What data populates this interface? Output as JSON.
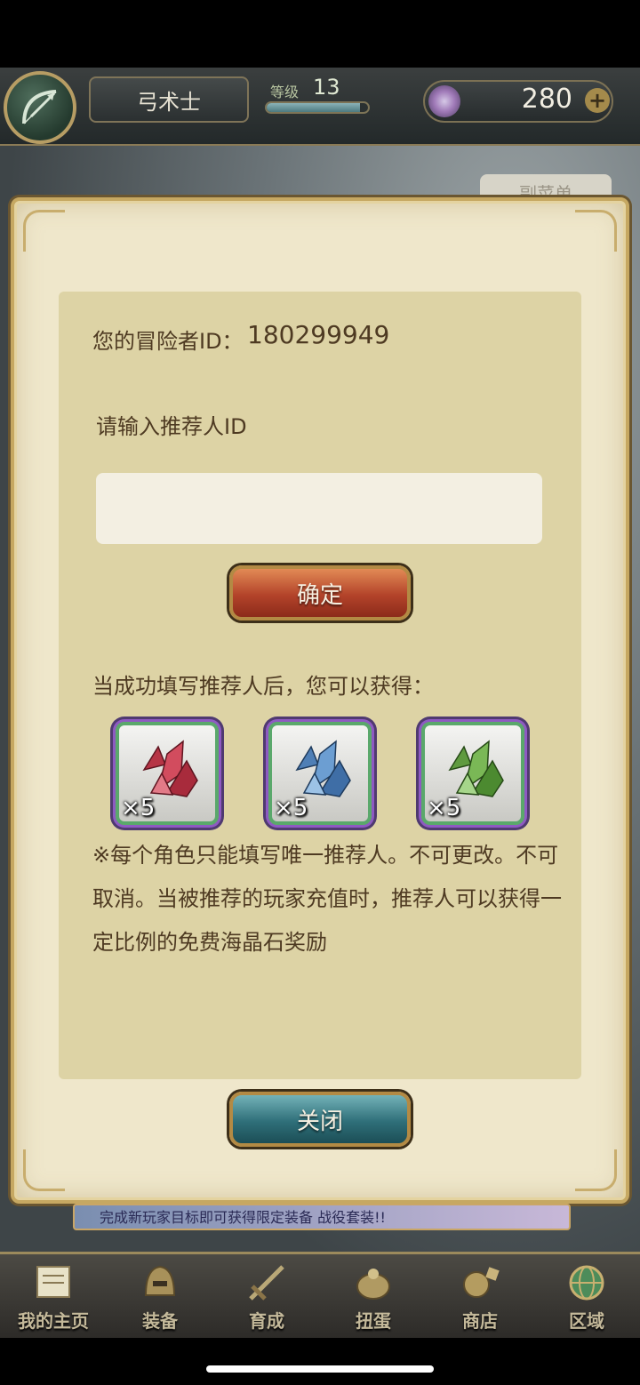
{
  "header": {
    "class_name": "弓术士",
    "level_label": "等级",
    "level_value": "13",
    "level_progress": 0.92,
    "gem_count": "280",
    "gem_plus": "+",
    "submenu_tab": "副菜单"
  },
  "dialog": {
    "adventurer_label": "您的冒险者ID：",
    "adventurer_id": "180299949",
    "prompt": "请输入推荐人ID",
    "input_value": "",
    "confirm_label": "确定",
    "reward_caption": "当成功填写推荐人后，您可以获得：",
    "rewards": [
      {
        "name": "red-crystal",
        "qty": "×5",
        "color": "#c43f52"
      },
      {
        "name": "blue-crystal",
        "qty": "×5",
        "color": "#5d8fc4"
      },
      {
        "name": "green-crystal",
        "qty": "×5",
        "color": "#6aa648"
      }
    ],
    "notice": "※每个角色只能填写唯一推荐人。不可更改。不可取消。当被推荐的玩家充值时，推荐人可以获得一定比例的免费海晶石奖励",
    "close_label": "关闭"
  },
  "banner": {
    "text": "完成新玩家目标即可获得限定装备 战役套装!!"
  },
  "bottom_nav": [
    {
      "label": "我的主页",
      "icon": "scroll-icon"
    },
    {
      "label": "装备",
      "icon": "helmet-icon"
    },
    {
      "label": "育成",
      "icon": "sword-icon"
    },
    {
      "label": "扭蛋",
      "icon": "gacha-icon"
    },
    {
      "label": "商店",
      "icon": "shop-icon"
    },
    {
      "label": "区域",
      "icon": "globe-icon"
    }
  ],
  "colors": {
    "confirm_button": "#b3432a",
    "close_button": "#2f6f79",
    "dialog_bg": "#efe7cb",
    "panel_bg": "#ddd3a5",
    "text": "#4e3a22"
  }
}
